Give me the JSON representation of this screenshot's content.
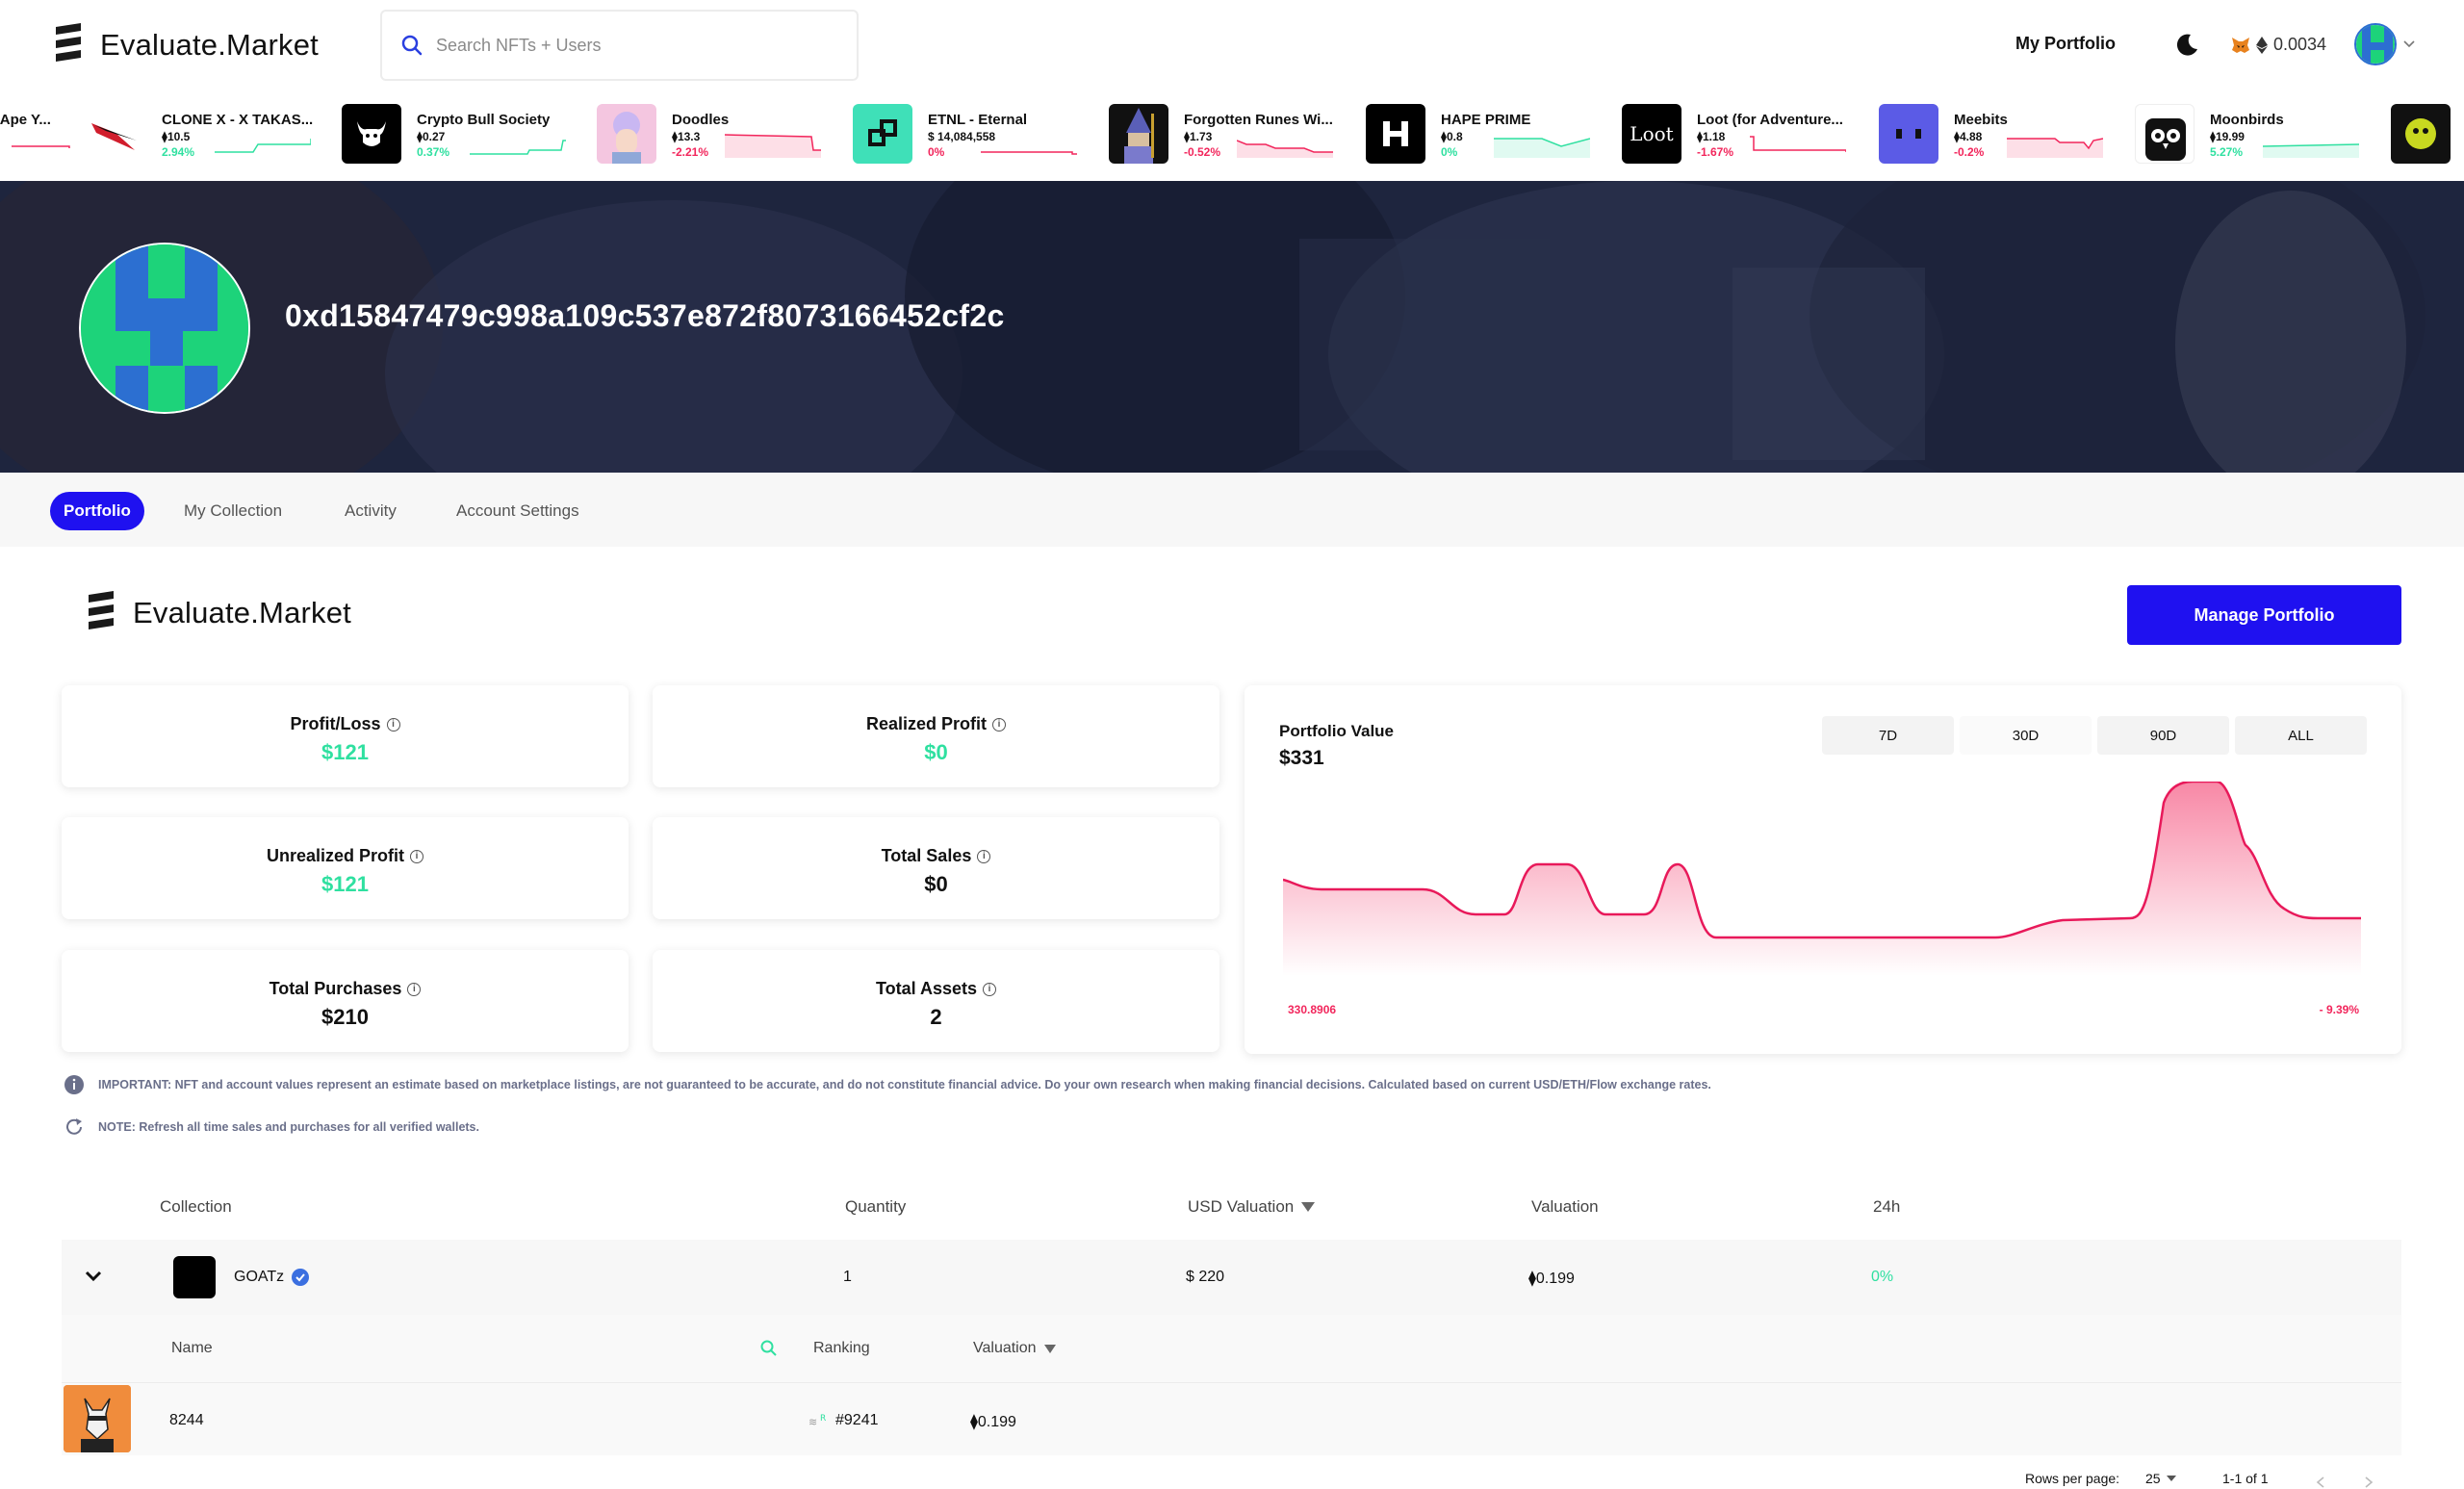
{
  "app": {
    "brand": "Evaluate.Market"
  },
  "search": {
    "placeholder": "Search NFTs + Users"
  },
  "nav": {
    "portfolio_label": "My Portfolio",
    "wallet_balance": "0.0034"
  },
  "ticker": [
    {
      "name": "l Ape Y...",
      "price": "",
      "change": "",
      "dir": "down"
    },
    {
      "name": "CLONE X - X TAKAS...",
      "price": "10.5",
      "change": "2.94%",
      "dir": "up"
    },
    {
      "name": "Crypto Bull Society",
      "price": "0.27",
      "change": "0.37%",
      "dir": "up"
    },
    {
      "name": "Doodles",
      "price": "13.3",
      "change": "-2.21%",
      "dir": "down"
    },
    {
      "name": "ETNL - Eternal",
      "price": "$ 14,084,558",
      "change": "0%",
      "dir": "down"
    },
    {
      "name": "Forgotten Runes Wi...",
      "price": "1.73",
      "change": "-0.52%",
      "dir": "down"
    },
    {
      "name": "HAPE PRIME",
      "price": "0.8",
      "change": "0%",
      "dir": "up"
    },
    {
      "name": "Loot (for Adventure...",
      "price": "1.18",
      "change": "-1.67%",
      "dir": "down",
      "logo_text": "Loot"
    },
    {
      "name": "Meebits",
      "price": "4.88",
      "change": "-0.2%",
      "dir": "down"
    },
    {
      "name": "Moonbirds",
      "price": "19.99",
      "change": "5.27%",
      "dir": "up"
    }
  ],
  "profile": {
    "address": "0xd15847479c998a109c537e872f8073166452cf2c"
  },
  "tabs": [
    "Portfolio",
    "My Collection",
    "Activity",
    "Account Settings"
  ],
  "section": {
    "manage_label": "Manage Portfolio"
  },
  "stats": {
    "profit_loss": {
      "label": "Profit/Loss",
      "value": "$121"
    },
    "realized_profit": {
      "label": "Realized Profit",
      "value": "$0"
    },
    "unrealized_profit": {
      "label": "Unrealized Profit",
      "value": "$121"
    },
    "total_sales": {
      "label": "Total Sales",
      "value": "$0"
    },
    "total_purchases": {
      "label": "Total Purchases",
      "value": "$210"
    },
    "total_assets": {
      "label": "Total Assets",
      "value": "2"
    }
  },
  "portfolio_chart": {
    "title": "Portfolio Value",
    "value": "$331",
    "ranges": [
      "7D",
      "30D",
      "90D",
      "ALL"
    ],
    "selected_range": "30D",
    "low_label": "330.8906",
    "change_label": "- 9.39%",
    "line_color": "#e8195a"
  },
  "notes": {
    "important": "IMPORTANT: NFT and account values represent an estimate based on marketplace listings, are not guaranteed to be accurate, and do not constitute financial advice. Do your own research when making financial decisions. Calculated based on current USD/ETH/Flow exchange rates.",
    "refresh": "NOTE: Refresh all time sales and purchases for all verified wallets."
  },
  "table": {
    "headers": {
      "collection": "Collection",
      "quantity": "Quantity",
      "usd_valuation": "USD Valuation",
      "valuation": "Valuation",
      "change_24h": "24h"
    },
    "row": {
      "collection": "GOATz",
      "quantity": "1",
      "usd_valuation": "$ 220",
      "valuation": "0.199",
      "change_24h": "0%"
    },
    "sub_headers": {
      "name": "Name",
      "ranking": "Ranking",
      "valuation": "Valuation"
    },
    "sub_row": {
      "name": "8244",
      "ranking": "#9241",
      "valuation": "0.199"
    },
    "footer": {
      "rows_per_page_label": "Rows per page:",
      "rows_per_page": "25",
      "range": "1-1 of 1"
    }
  },
  "colors": {
    "accent": "#1f11f0",
    "positive": "#2fe0a0",
    "negative": "#f2265c"
  }
}
